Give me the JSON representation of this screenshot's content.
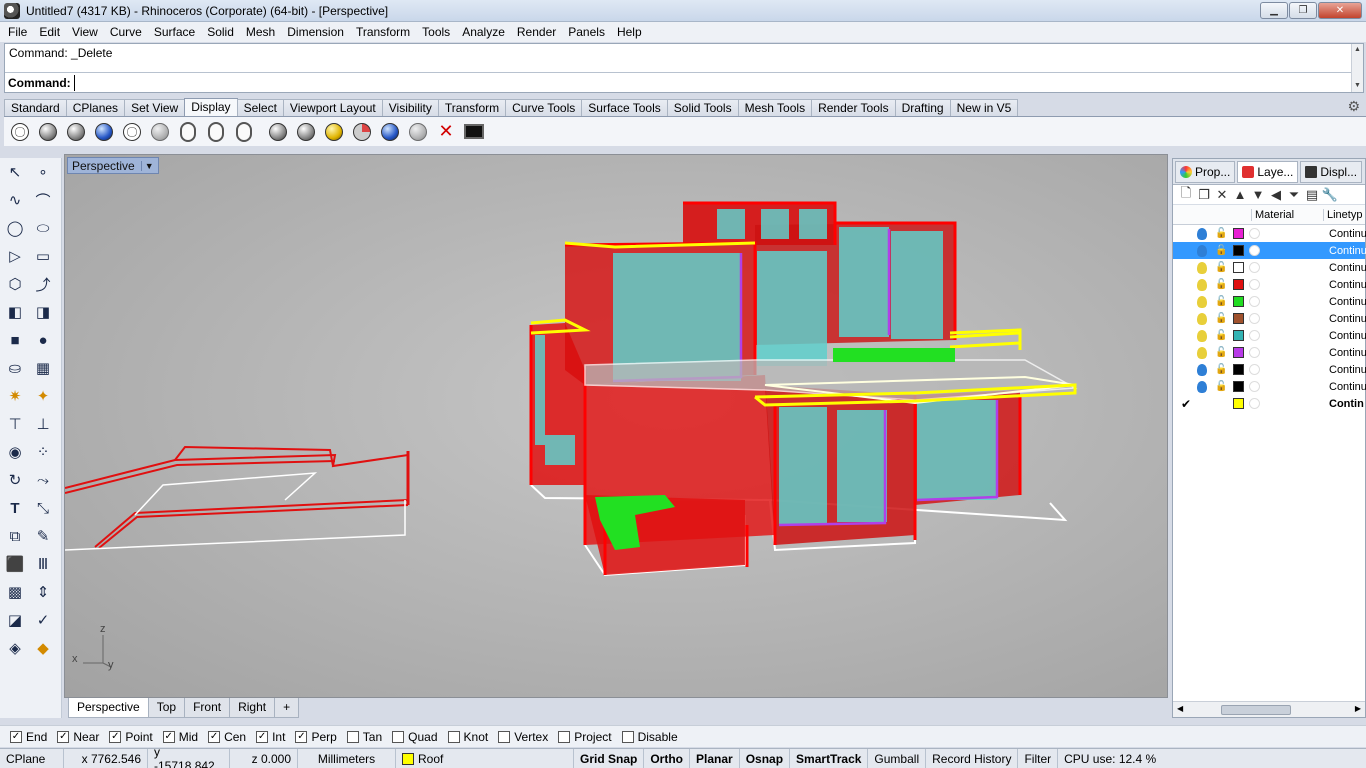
{
  "window": {
    "title": "Untitled7 (4317 KB) - Rhinoceros (Corporate) (64-bit) - [Perspective]"
  },
  "menu": [
    "File",
    "Edit",
    "View",
    "Curve",
    "Surface",
    "Solid",
    "Mesh",
    "Dimension",
    "Transform",
    "Tools",
    "Analyze",
    "Render",
    "Panels",
    "Help"
  ],
  "command": {
    "history": "Command: _Delete",
    "prompt": "Command:",
    "value": ""
  },
  "toolbar_tabs": [
    "Standard",
    "CPlanes",
    "Set View",
    "Display",
    "Select",
    "Viewport Layout",
    "Visibility",
    "Transform",
    "Curve Tools",
    "Surface Tools",
    "Solid Tools",
    "Mesh Tools",
    "Render Tools",
    "Drafting",
    "New in V5"
  ],
  "active_toolbar_tab": "Display",
  "viewport": {
    "title": "Perspective",
    "axis_x": "x",
    "axis_y": "y",
    "axis_z": "z"
  },
  "viewport_tabs": [
    "Perspective",
    "Top",
    "Front",
    "Right",
    "+"
  ],
  "right_panel": {
    "tabs": [
      "Prop...",
      "Laye...",
      "Displ..."
    ],
    "columns": {
      "material": "Material",
      "linetype": "Linetyp"
    },
    "layers": [
      {
        "color": "#e81fd3",
        "bulb": "#2e7fd6",
        "linetype": "Continu"
      },
      {
        "color": "#000000",
        "bulb": "#2e7fd6",
        "linetype": "Continu",
        "selected": true
      },
      {
        "color": "#ffffff",
        "bulb": "#e8cf3a",
        "linetype": "Continu"
      },
      {
        "color": "#e01010",
        "bulb": "#e8cf3a",
        "linetype": "Continu"
      },
      {
        "color": "#22dd22",
        "bulb": "#e8cf3a",
        "linetype": "Continu"
      },
      {
        "color": "#a0522d",
        "bulb": "#e8cf3a",
        "linetype": "Continu"
      },
      {
        "color": "#33b3b3",
        "bulb": "#e8cf3a",
        "linetype": "Continu"
      },
      {
        "color": "#b83ae8",
        "bulb": "#e8cf3a",
        "linetype": "Continu"
      },
      {
        "color": "#000000",
        "bulb": "#2e7fd6",
        "linetype": "Continu"
      },
      {
        "color": "#000000",
        "bulb": "#2e7fd6",
        "linetype": "Continu"
      },
      {
        "color": "#ffff00",
        "bulb": "",
        "linetype": "Contin",
        "current": true
      }
    ]
  },
  "osnaps": [
    {
      "label": "End",
      "checked": true
    },
    {
      "label": "Near",
      "checked": true
    },
    {
      "label": "Point",
      "checked": true
    },
    {
      "label": "Mid",
      "checked": true
    },
    {
      "label": "Cen",
      "checked": true
    },
    {
      "label": "Int",
      "checked": true
    },
    {
      "label": "Perp",
      "checked": true
    },
    {
      "label": "Tan",
      "checked": false
    },
    {
      "label": "Quad",
      "checked": false
    },
    {
      "label": "Knot",
      "checked": false
    },
    {
      "label": "Vertex",
      "checked": false
    },
    {
      "label": "Project",
      "checked": false
    },
    {
      "label": "Disable",
      "checked": false
    }
  ],
  "status": {
    "cplane": "CPlane",
    "x": "x 7762.546",
    "y": "y -15718.842",
    "z": "z 0.000",
    "units": "Millimeters",
    "layer": "Roof",
    "layer_color": "#ffff00",
    "grid_snap": "Grid Snap",
    "ortho": "Ortho",
    "planar": "Planar",
    "osnap": "Osnap",
    "smarttrack": "SmartTrack",
    "gumball": "Gumball",
    "record_history": "Record History",
    "filter": "Filter",
    "cpu": "CPU use: 12.4 %"
  }
}
